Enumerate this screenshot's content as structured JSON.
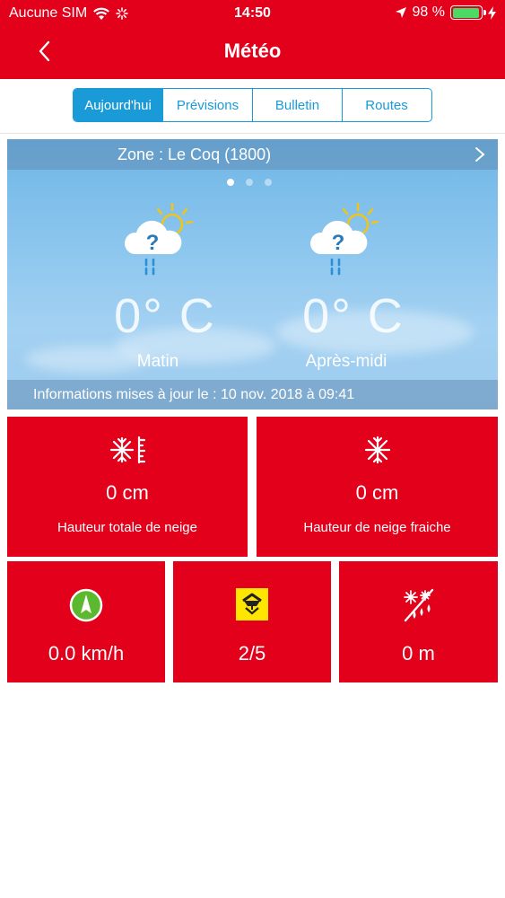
{
  "status_bar": {
    "carrier": "Aucune SIM",
    "time": "14:50",
    "battery_percent": "98 %",
    "battery_level": 0.98
  },
  "nav": {
    "title": "Météo"
  },
  "tabs": [
    {
      "label": "Aujourd'hui",
      "active": true
    },
    {
      "label": "Prévisions",
      "active": false
    },
    {
      "label": "Bulletin",
      "active": false
    },
    {
      "label": "Routes",
      "active": false
    }
  ],
  "weather": {
    "zone": "Zone : Le Coq (1800)",
    "pager": {
      "count": 3,
      "current": 1
    },
    "morning": {
      "temp": "0° C",
      "label": "Matin",
      "icon": "unknown-weather-rain-sun-icon"
    },
    "afternoon": {
      "temp": "0° C",
      "label": "Après-midi",
      "icon": "unknown-weather-rain-sun-icon"
    },
    "updated": "Informations mises à jour le : 10 nov. 2018 à 09:41"
  },
  "stats": {
    "total_snow": {
      "value": "0  cm",
      "caption": "Hauteur totale de neige",
      "icon": "snow-gauge-icon"
    },
    "fresh_snow": {
      "value": "0  cm",
      "caption": "Hauteur de neige fraiche",
      "icon": "snowflake-icon"
    },
    "wind": {
      "value": "0.0 km/h",
      "icon": "wind-direction-icon"
    },
    "avalanche": {
      "value": "2/5",
      "icon": "avalanche-risk-icon"
    },
    "snow_limit": {
      "value": "0  m",
      "icon": "snow-rain-limit-icon"
    }
  },
  "colors": {
    "brand_red": "#e2001a",
    "tab_blue": "#1a9ad6",
    "avalanche_yellow": "#ffe600",
    "compass_green": "#5cb82e"
  }
}
